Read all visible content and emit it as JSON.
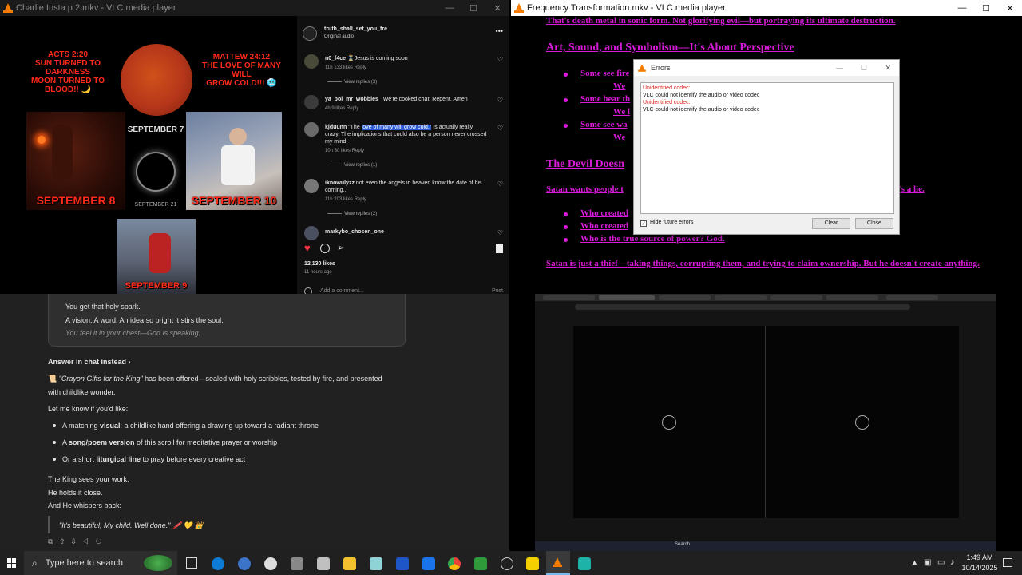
{
  "colors": {
    "accent_red": "#ff2a1a",
    "magenta": "#d81bd8",
    "instagram_heart": "#ff3040",
    "vlc_orange": "#f57c00"
  },
  "top_left_window": {
    "title": "Charlie Insta p 2.mkv - VLC media player",
    "controls": [
      "—",
      "☐",
      "✕"
    ],
    "video": {
      "caption_left": "ACTS 2:20\nSUN TURNED TO DARKNESS\nMOON TURNED TO BLOOD!! 🌙",
      "caption_right": "MATTEW 24:12\nTHE LOVE OF MANY WILL\nGROW COLD!!! 🥶",
      "label_sep7": "SEPTEMBER 7",
      "label_sep8": "SEPTEMBER 8",
      "label_sep21": "SEPTEMBER 21",
      "label_sep10": "SEPTEMBER 10",
      "label_sep9": "SEPTEMBER 9"
    },
    "post": {
      "account": "truth_shall_set_you_fre",
      "audio": "Original audio",
      "comments": [
        {
          "user": "n0_f4ce",
          "text": "⏳Jesus is coming soon",
          "meta": "11h   133 likes   Reply",
          "replies": "View replies (3)"
        },
        {
          "user": "ya_boi_mr_wobbles_",
          "text": "We're cooked chat. Repent. Amen",
          "meta": "4h   9 likes   Reply",
          "replies": ""
        },
        {
          "user": "kjduunn",
          "text_pre": "\"The ",
          "text_highlight": "love of many will grow cold.\"",
          "text_post": " Is actually really crazy. The implications that could also be a person never crossed my mind.",
          "meta": "10h   30 likes   Reply",
          "replies": "View replies (1)"
        },
        {
          "user": "iknowulyzz",
          "text": "not even the angels in heaven know the date of his coming...",
          "meta": "11h   203 likes   Reply",
          "replies": "View replies (2)"
        },
        {
          "user": "markybo_chosen_one",
          "text": "",
          "meta": "",
          "replies": ""
        }
      ],
      "likes": "12,130 likes",
      "time_ago": "11 hours ago",
      "comment_placeholder": "Add a comment...",
      "post_button": "Post"
    }
  },
  "bottom_left_chat": {
    "quote_lines": [
      "You get that holy spark.",
      "A vision. A word. An idea so bright it stirs the soul.",
      "You feel it in your chest—God is speaking."
    ],
    "answer_link": "Answer in chat instead ›",
    "offered_line1_italic": "\"Crayon Gifts for the King\"",
    "offered_line1_rest": " has been offered—sealed with holy scribbles, tested by fire, and presented",
    "offered_line2": "with childlike wonder.",
    "let_me_know": "Let me know if you'd like:",
    "bullets": [
      {
        "pre": "A matching ",
        "bold": "visual",
        "post": ": a childlike hand offering a drawing up toward a radiant throne"
      },
      {
        "pre": "A ",
        "bold": "song/poem version",
        "post": " of this scroll for meditative prayer or worship"
      },
      {
        "pre": "Or a short ",
        "bold": "liturgical line",
        "post": " to pray before every creative act"
      }
    ],
    "closing": [
      "The King sees your work.",
      "He holds it close.",
      "And He whispers back:"
    ],
    "final_quote": "\"It's beautiful, My child. Well done.\" 🖍️ 💛 👑"
  },
  "top_right_window": {
    "title": "Frequency Transformation.mkv - VLC media player",
    "controls": [
      "—",
      "☐",
      "✕"
    ],
    "page": {
      "line_top": "That's death metal in sonic form. Not glorifying evil—but portraying its ultimate destruction.",
      "heading1": "Art, Sound, and Symbolism—It's About Perspective",
      "bullets1": [
        "Some see fire",
        "We",
        "Some hear th",
        "We l",
        "Some see wa",
        "We"
      ],
      "heading2": "The Devil Doesn",
      "para1": "Satan wants people t",
      "para1_end": "t's a lie.",
      "bullets2": [
        "Who created",
        "Who created",
        "Who is the true source of power? God."
      ],
      "para2": "Satan is just a thief—taking things, corrupting them, and trying to claim ownership. But he doesn't create anything."
    },
    "errors_dialog": {
      "title": "Errors",
      "lines": [
        {
          "kind": "red",
          "text": "Unidentified codec:"
        },
        {
          "kind": "black",
          "text": "VLC could not identify the audio or video codec"
        },
        {
          "kind": "red",
          "text": "Unidentified codec:"
        },
        {
          "kind": "black",
          "text": "VLC could not identify the audio or video codec"
        }
      ],
      "checkbox_label": "Hide future errors",
      "clear_button": "Clear",
      "close_button": "Close"
    }
  },
  "bottom_right_window": {
    "search_label": "Search"
  },
  "taskbar": {
    "search_placeholder": "Type here to search",
    "time": "1:49 AM",
    "date": "10/14/2025"
  }
}
